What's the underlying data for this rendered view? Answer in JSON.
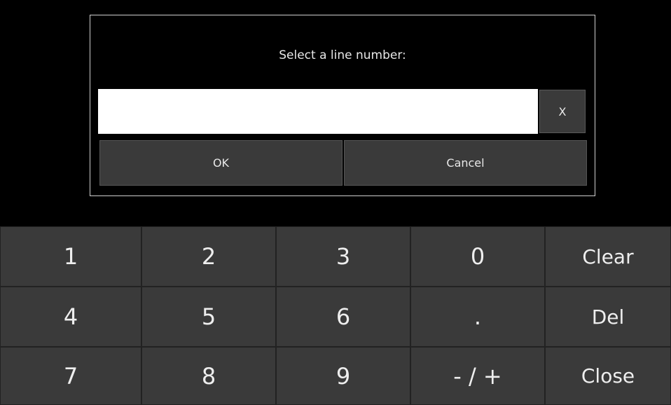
{
  "dialog": {
    "title": "Select a line number:",
    "input_value": "",
    "clear_input_label": "X",
    "ok_label": "OK",
    "cancel_label": "Cancel"
  },
  "keypad": {
    "keys": [
      "1",
      "2",
      "3",
      "0",
      "Clear",
      "4",
      "5",
      "6",
      ".",
      "Del",
      "7",
      "8",
      "9",
      "- / +",
      "Close"
    ]
  },
  "colors": {
    "background": "#000000",
    "button": "#3a3a3a",
    "text": "#eeeeee",
    "input": "#ffffff"
  }
}
